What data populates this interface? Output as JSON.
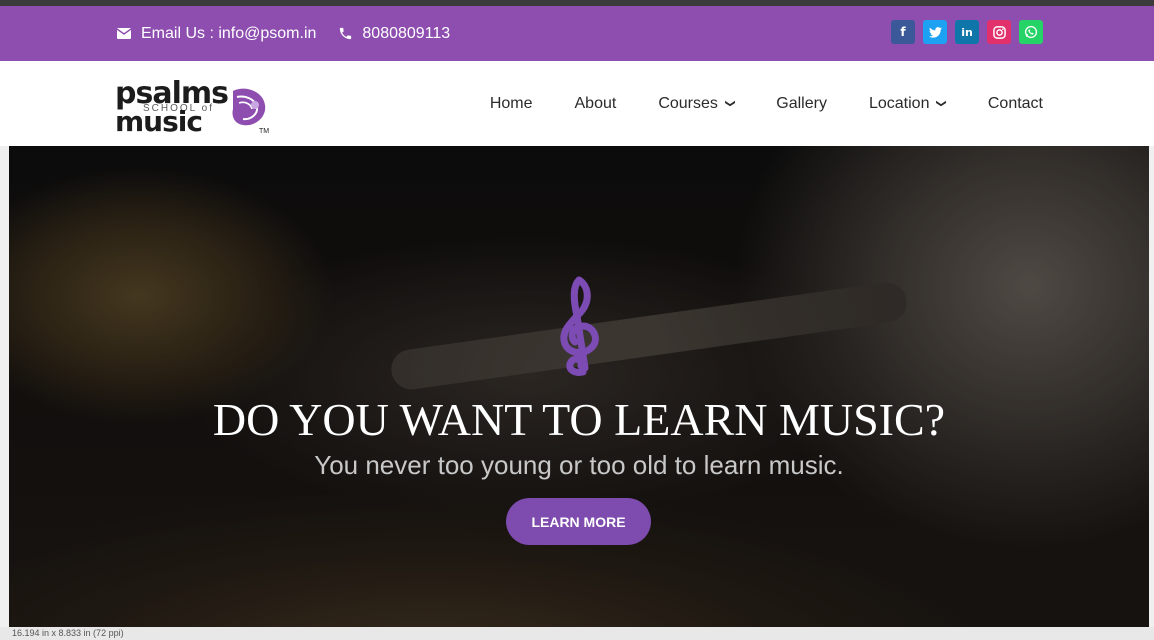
{
  "topbar": {
    "email_label": "Email Us : info@psom.in",
    "phone": "8080809113",
    "social": [
      {
        "icon": "facebook-icon",
        "glyph": "f",
        "color": "#3b5998"
      },
      {
        "icon": "twitter-icon",
        "glyph": "t",
        "color": "#1da1f2"
      },
      {
        "icon": "linkedin-icon",
        "glyph": "in",
        "color": "#0e76a8"
      },
      {
        "icon": "instagram-icon",
        "glyph": "◎",
        "color": "#e1306c"
      },
      {
        "icon": "whatsapp-icon",
        "glyph": "✆",
        "color": "#25d366"
      }
    ]
  },
  "logo": {
    "line1": "psalms",
    "line2": "SCHOOL of",
    "line3": "music",
    "tm": "TM"
  },
  "nav": {
    "items": [
      "Home",
      "About",
      "Courses",
      "Gallery",
      "Location",
      "Contact"
    ]
  },
  "hero": {
    "heading": "DO YOU WANT TO LEARN MUSIC?",
    "subheading": "You never too young or too old to learn music.",
    "button": "LEARN MORE",
    "clef": "𝄞"
  },
  "status": {
    "text": "16.194 in x 8.833 in (72 ppi)"
  },
  "colors": {
    "brand": "#8e4eb0",
    "button": "#7e4bae"
  }
}
